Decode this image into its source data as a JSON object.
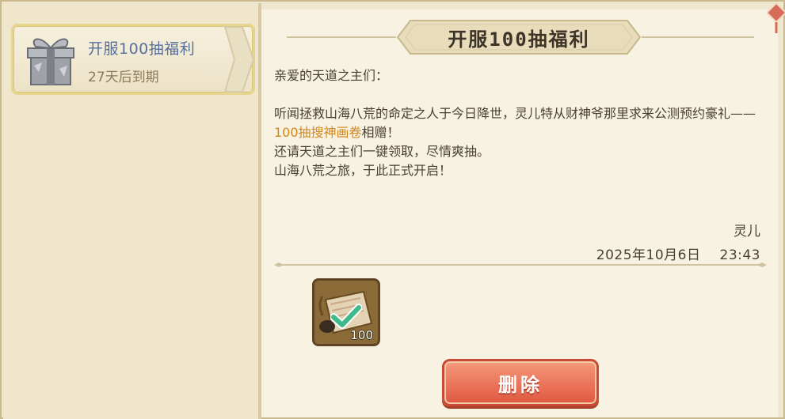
{
  "mail_list": {
    "items": [
      {
        "title": "开服100抽福利",
        "expire": "27天后到期",
        "icon": "gift-box-icon"
      }
    ]
  },
  "mail": {
    "title": "开服100抽福利",
    "greeting": "亲爱的天道之主们：",
    "body_part1": "听闻拯救山海八荒的命定之人于今日降世，灵儿特从财神爷那里求来公测预约豪礼——",
    "body_highlight": "100抽搜神画卷",
    "body_part2": "相赠！",
    "line2": "还请天道之主们一键领取，尽情爽抽。",
    "line3": "山海八荒之旅，于此正式开启！",
    "sender": "灵儿",
    "date": "2025年10月6日",
    "time": "23:43"
  },
  "attachments": [
    {
      "icon": "scroll-icon",
      "count": "100",
      "claimed": true
    }
  ],
  "actions": {
    "delete_label": "删除"
  },
  "colors": {
    "highlight": "#d2871c",
    "title_blue": "#586f9a",
    "delete_red": "#e0563f"
  }
}
